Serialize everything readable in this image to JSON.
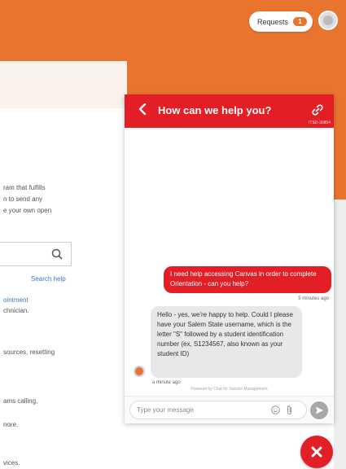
{
  "header": {
    "requests_label": "Requests",
    "requests_count": "1",
    "brand_color": "#e8742e"
  },
  "background_page": {
    "text_lines": [
      "ram that fulfills",
      "n to send any",
      "e your own open"
    ],
    "search_link": "Search help",
    "appointment_link": "ointment",
    "technician_text": "chnician.",
    "resources_text": "sources, resetting",
    "calling_text": "ams calling,",
    "more_text": "nore.",
    "services_text": "vices."
  },
  "chat": {
    "title": "How can we help you?",
    "id_code": "ITSD-30854",
    "accent_color": "#e21f26",
    "outgoing_message": "I need help accessing Canvas in order to complete Orientation - can you help?",
    "outgoing_time": "5 minutes ago",
    "incoming_message": "Hello - yes, we're happy to help. Could I please have your Salem State username, which is the letter \"S\" followed by a student identification number (ex, S1234567, also known as your student ID)",
    "incoming_time": "a minute ago",
    "powered_by": "Powered by Chat for Service Management",
    "input_placeholder": "Type your message"
  },
  "icons": {
    "back": "chevron-left-icon",
    "link": "link-icon",
    "emoji": "emoji-icon",
    "attach": "paperclip-icon",
    "send": "send-icon",
    "close": "close-icon",
    "search": "search-icon"
  }
}
